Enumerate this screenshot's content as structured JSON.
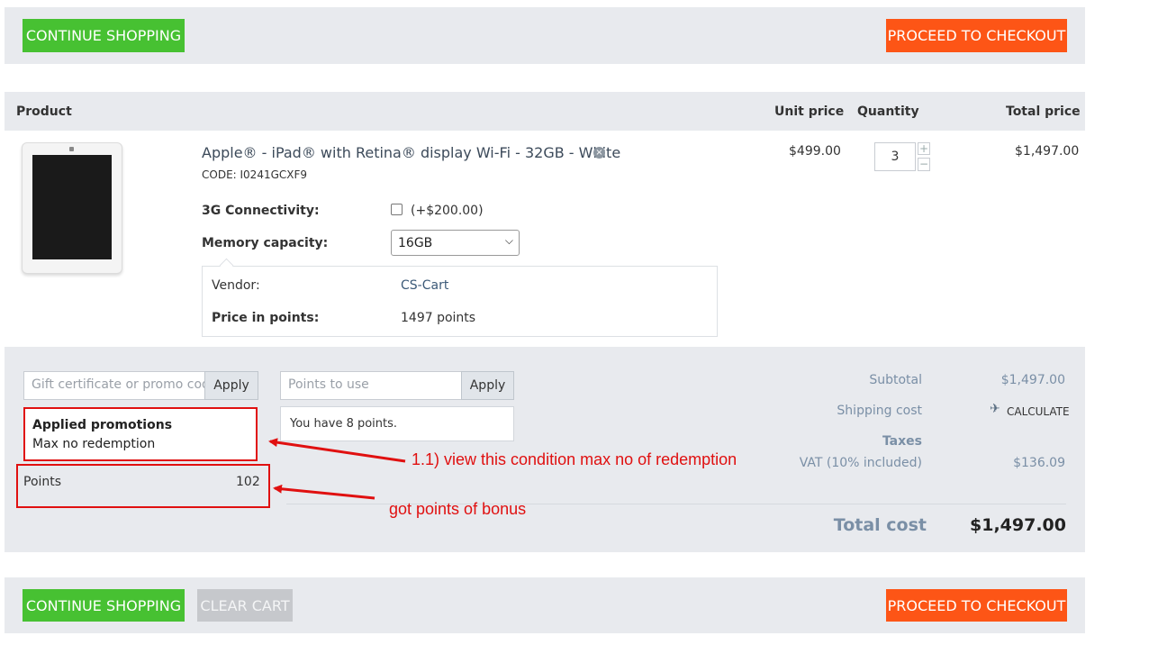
{
  "top_bar": {
    "continue_label": "CONTINUE SHOPPING",
    "checkout_label": "PROCEED TO CHECKOUT"
  },
  "table": {
    "headers": {
      "product": "Product",
      "unit_price": "Unit price",
      "quantity": "Quantity",
      "total_price": "Total price"
    },
    "item": {
      "name": "Apple® - iPad® with Retina® display Wi-Fi - 32GB - White",
      "code": "CODE: I0241GCXF9",
      "unit_price": "$499.00",
      "quantity": "3",
      "total_price": "$1,497.00",
      "options": {
        "connectivity_label": "3G Connectivity:",
        "connectivity_price": "(+$200.00)",
        "memory_label": "Memory capacity:",
        "memory_value": "16GB"
      },
      "details": {
        "vendor_label": "Vendor:",
        "vendor_value": "CS-Cart",
        "points_label": "Price in points:",
        "points_value": "1497 points"
      }
    }
  },
  "promo": {
    "gift_placeholder": "Gift certificate or promo code",
    "gift_apply": "Apply",
    "points_placeholder": "Points to use",
    "points_apply": "Apply",
    "points_note": "You have 8 points.",
    "applied_title": "Applied promotions",
    "applied_value": "Max no redemption",
    "points_row_label": "Points",
    "points_row_value": "102"
  },
  "summary": {
    "subtotal_label": "Subtotal",
    "subtotal_value": "$1,497.00",
    "shipping_label": "Shipping cost",
    "shipping_value": "CALCULATE",
    "taxes_label": "Taxes",
    "vat_label": "VAT (10% included)",
    "vat_value": "$136.09",
    "total_label": "Total cost",
    "total_value": "$1,497.00"
  },
  "annotations": {
    "note1": "1.1) view this condition max no of redemption",
    "note2": "got points of bonus"
  },
  "bottom_bar": {
    "continue_label": "CONTINUE SHOPPING",
    "clear_label": "CLEAR CART",
    "checkout_label": "PROCEED TO CHECKOUT"
  },
  "colors": {
    "green": "#47c132",
    "orange": "#fd5516",
    "annotation_red": "#e01010"
  }
}
